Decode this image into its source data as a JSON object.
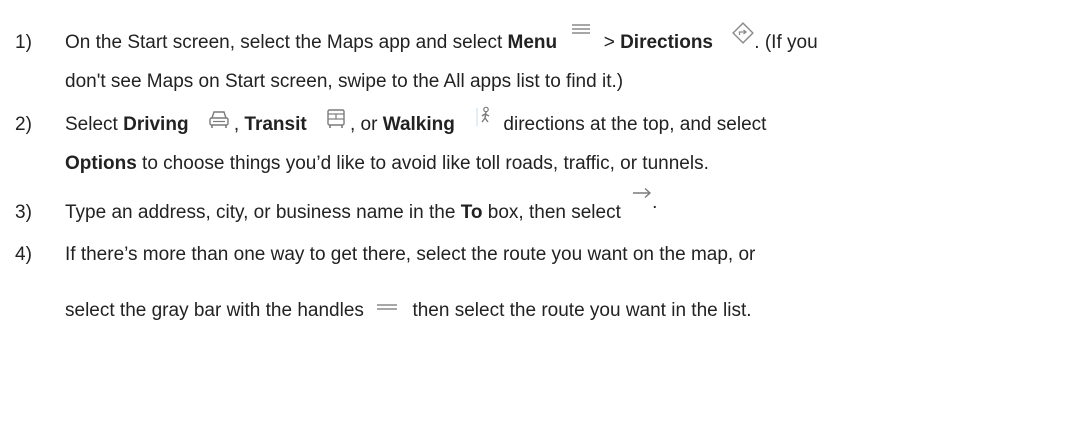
{
  "steps": [
    {
      "number": "1)",
      "line1": {
        "t1": "On the Start screen, select the Maps app and select ",
        "b1": "Menu",
        "t2": " > ",
        "b2": "Directions",
        "t3": ". (If you"
      },
      "line2": "don't see Maps on Start screen, swipe to the All apps list to find it.)",
      "icons": [
        "menu-icon",
        "directions-icon"
      ]
    },
    {
      "number": "2)",
      "line1": {
        "t1": "Select ",
        "b1": "Driving",
        "t2": ", ",
        "b2": "Transit",
        "t3": ", or ",
        "b3": "Walking",
        "t4": " directions at the top, and select"
      },
      "line2": {
        "b1": "Options",
        "t1": " to choose things you’d like to avoid like toll roads, traffic, or tunnels."
      },
      "icons": [
        "car-icon",
        "bus-icon",
        "walking-icon"
      ]
    },
    {
      "number": "3)",
      "line1": {
        "t1": "Type an address, city, or business name in the ",
        "b1": "To",
        "t2": " box, then select ",
        "t3": "."
      },
      "icons": [
        "arrow-right-icon"
      ]
    },
    {
      "number": "4)",
      "line1": "If there’s more than one way to get there, select the route you want on the map, or",
      "line2": {
        "t1": "select the gray bar with the handles ",
        "t2": " then select the route you want in the list."
      },
      "icons": [
        "handles-icon"
      ]
    }
  ]
}
